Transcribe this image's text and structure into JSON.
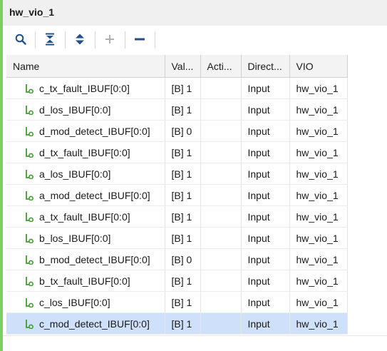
{
  "window": {
    "title": "hw_vio_1"
  },
  "toolbar": {
    "icons": [
      "search-icon",
      "collapse-all-icon",
      "expand-all-icon",
      "add-icon",
      "remove-icon"
    ]
  },
  "table": {
    "columns": [
      "Name",
      "Val...",
      "Acti...",
      "Direct...",
      "VIO"
    ],
    "rows": [
      {
        "name": "c_tx_fault_IBUF[0:0]",
        "value": "[B] 1",
        "activity": "",
        "direction": "Input",
        "vio": "hw_vio_1"
      },
      {
        "name": "d_los_IBUF[0:0]",
        "value": "[B] 1",
        "activity": "",
        "direction": "Input",
        "vio": "hw_vio_1"
      },
      {
        "name": "d_mod_detect_IBUF[0:0]",
        "value": "[B] 0",
        "activity": "",
        "direction": "Input",
        "vio": "hw_vio_1"
      },
      {
        "name": "d_tx_fault_IBUF[0:0]",
        "value": "[B] 1",
        "activity": "",
        "direction": "Input",
        "vio": "hw_vio_1"
      },
      {
        "name": "a_los_IBUF[0:0]",
        "value": "[B] 1",
        "activity": "",
        "direction": "Input",
        "vio": "hw_vio_1"
      },
      {
        "name": "a_mod_detect_IBUF[0:0]",
        "value": "[B] 1",
        "activity": "",
        "direction": "Input",
        "vio": "hw_vio_1"
      },
      {
        "name": "a_tx_fault_IBUF[0:0]",
        "value": "[B] 1",
        "activity": "",
        "direction": "Input",
        "vio": "hw_vio_1"
      },
      {
        "name": "b_los_IBUF[0:0]",
        "value": "[B] 1",
        "activity": "",
        "direction": "Input",
        "vio": "hw_vio_1"
      },
      {
        "name": "b_mod_detect_IBUF[0:0]",
        "value": "[B] 0",
        "activity": "",
        "direction": "Input",
        "vio": "hw_vio_1"
      },
      {
        "name": "b_tx_fault_IBUF[0:0]",
        "value": "[B] 1",
        "activity": "",
        "direction": "Input",
        "vio": "hw_vio_1"
      },
      {
        "name": "c_los_IBUF[0:0]",
        "value": "[B] 1",
        "activity": "",
        "direction": "Input",
        "vio": "hw_vio_1"
      },
      {
        "name": "c_mod_detect_IBUF[0:0]",
        "value": "[B] 1",
        "activity": "",
        "direction": "Input",
        "vio": "hw_vio_1",
        "selected": true
      }
    ]
  },
  "colors": {
    "accent_green": "#7bd160",
    "probe_icon_green": "#3f9e2f",
    "selected_row": "#cfe0fa",
    "toolbar_blue": "#1f4f8c"
  }
}
